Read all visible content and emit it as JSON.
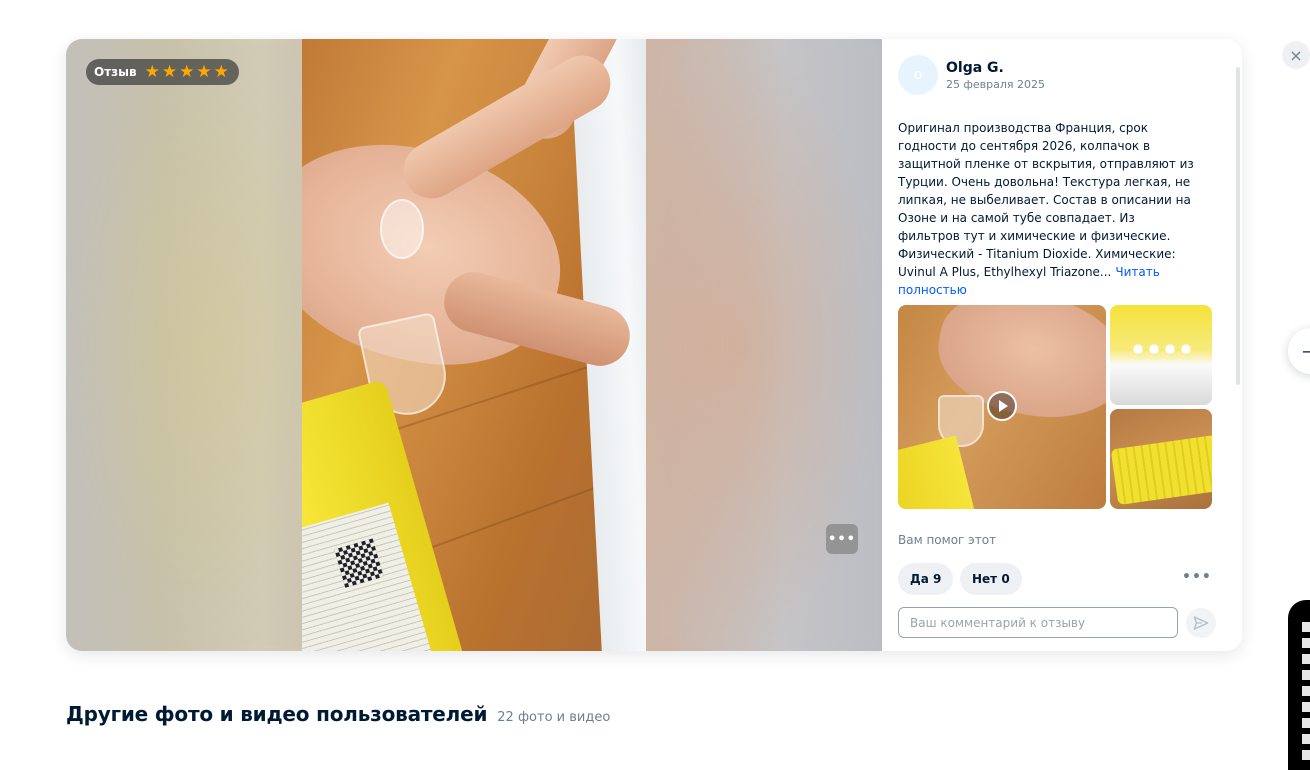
{
  "review": {
    "badge_label": "Отзыв",
    "rating": 5,
    "author_name": "Olga G.",
    "date": "25 февраля 2025",
    "text": "Оригинал производства Франция, срок годности до сентября 2026, колпачок в защитной пленке от вскрытия, отправляют из Турции. Очень довольна! Текстура легкая, не липкая, не выбеливает. Состав в описании на Озоне и на самой тубе совпадает. Из фильтров тут и химические и физические. Физический - Titanium Dioxide. Химические: Uvinul A Plus, Ethylhexyl Triazone...",
    "read_more": "Читать полностью",
    "helpful_question": "Вам помог этот",
    "yes_label": "Да 9",
    "no_label": "Нет 0",
    "more_dots": "•••",
    "comment_placeholder": "Ваш комментарий к отзыву"
  },
  "media": {
    "more_label": "•••"
  },
  "icons": {
    "close": "×",
    "star": "★",
    "avatar": "o",
    "next": "→"
  },
  "gallery": {
    "title": "Другие фото и видео пользователей",
    "count": "22 фото и видео"
  },
  "colors": {
    "link": "#005bff",
    "star": "#ffa800",
    "text": "#001a34",
    "secondary": "#707f8d"
  }
}
